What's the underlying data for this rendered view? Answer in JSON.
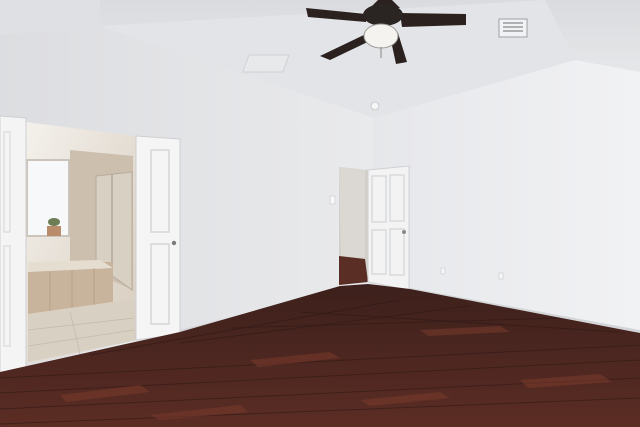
{
  "scene": {
    "description_free": true,
    "colors": {
      "ceiling": "#e7e8ea",
      "left_wall": "#e2e3e6",
      "right_wall": "#eceef0",
      "back_wall": "#e4e5e8",
      "floor_dark": "#3a1f1c",
      "floor_mid": "#5a2c24",
      "floor_light": "#7a3a2c",
      "door": "#f3f3f4",
      "bath_tile": "#c9b9a6",
      "bath_floor": "#d8cfc3",
      "fan_blade": "#2b2220"
    },
    "icons": [
      "ceiling-fan-icon",
      "air-vent-icon",
      "smoke-detector-icon",
      "door-knob-icon",
      "potted-plant-icon"
    ]
  }
}
